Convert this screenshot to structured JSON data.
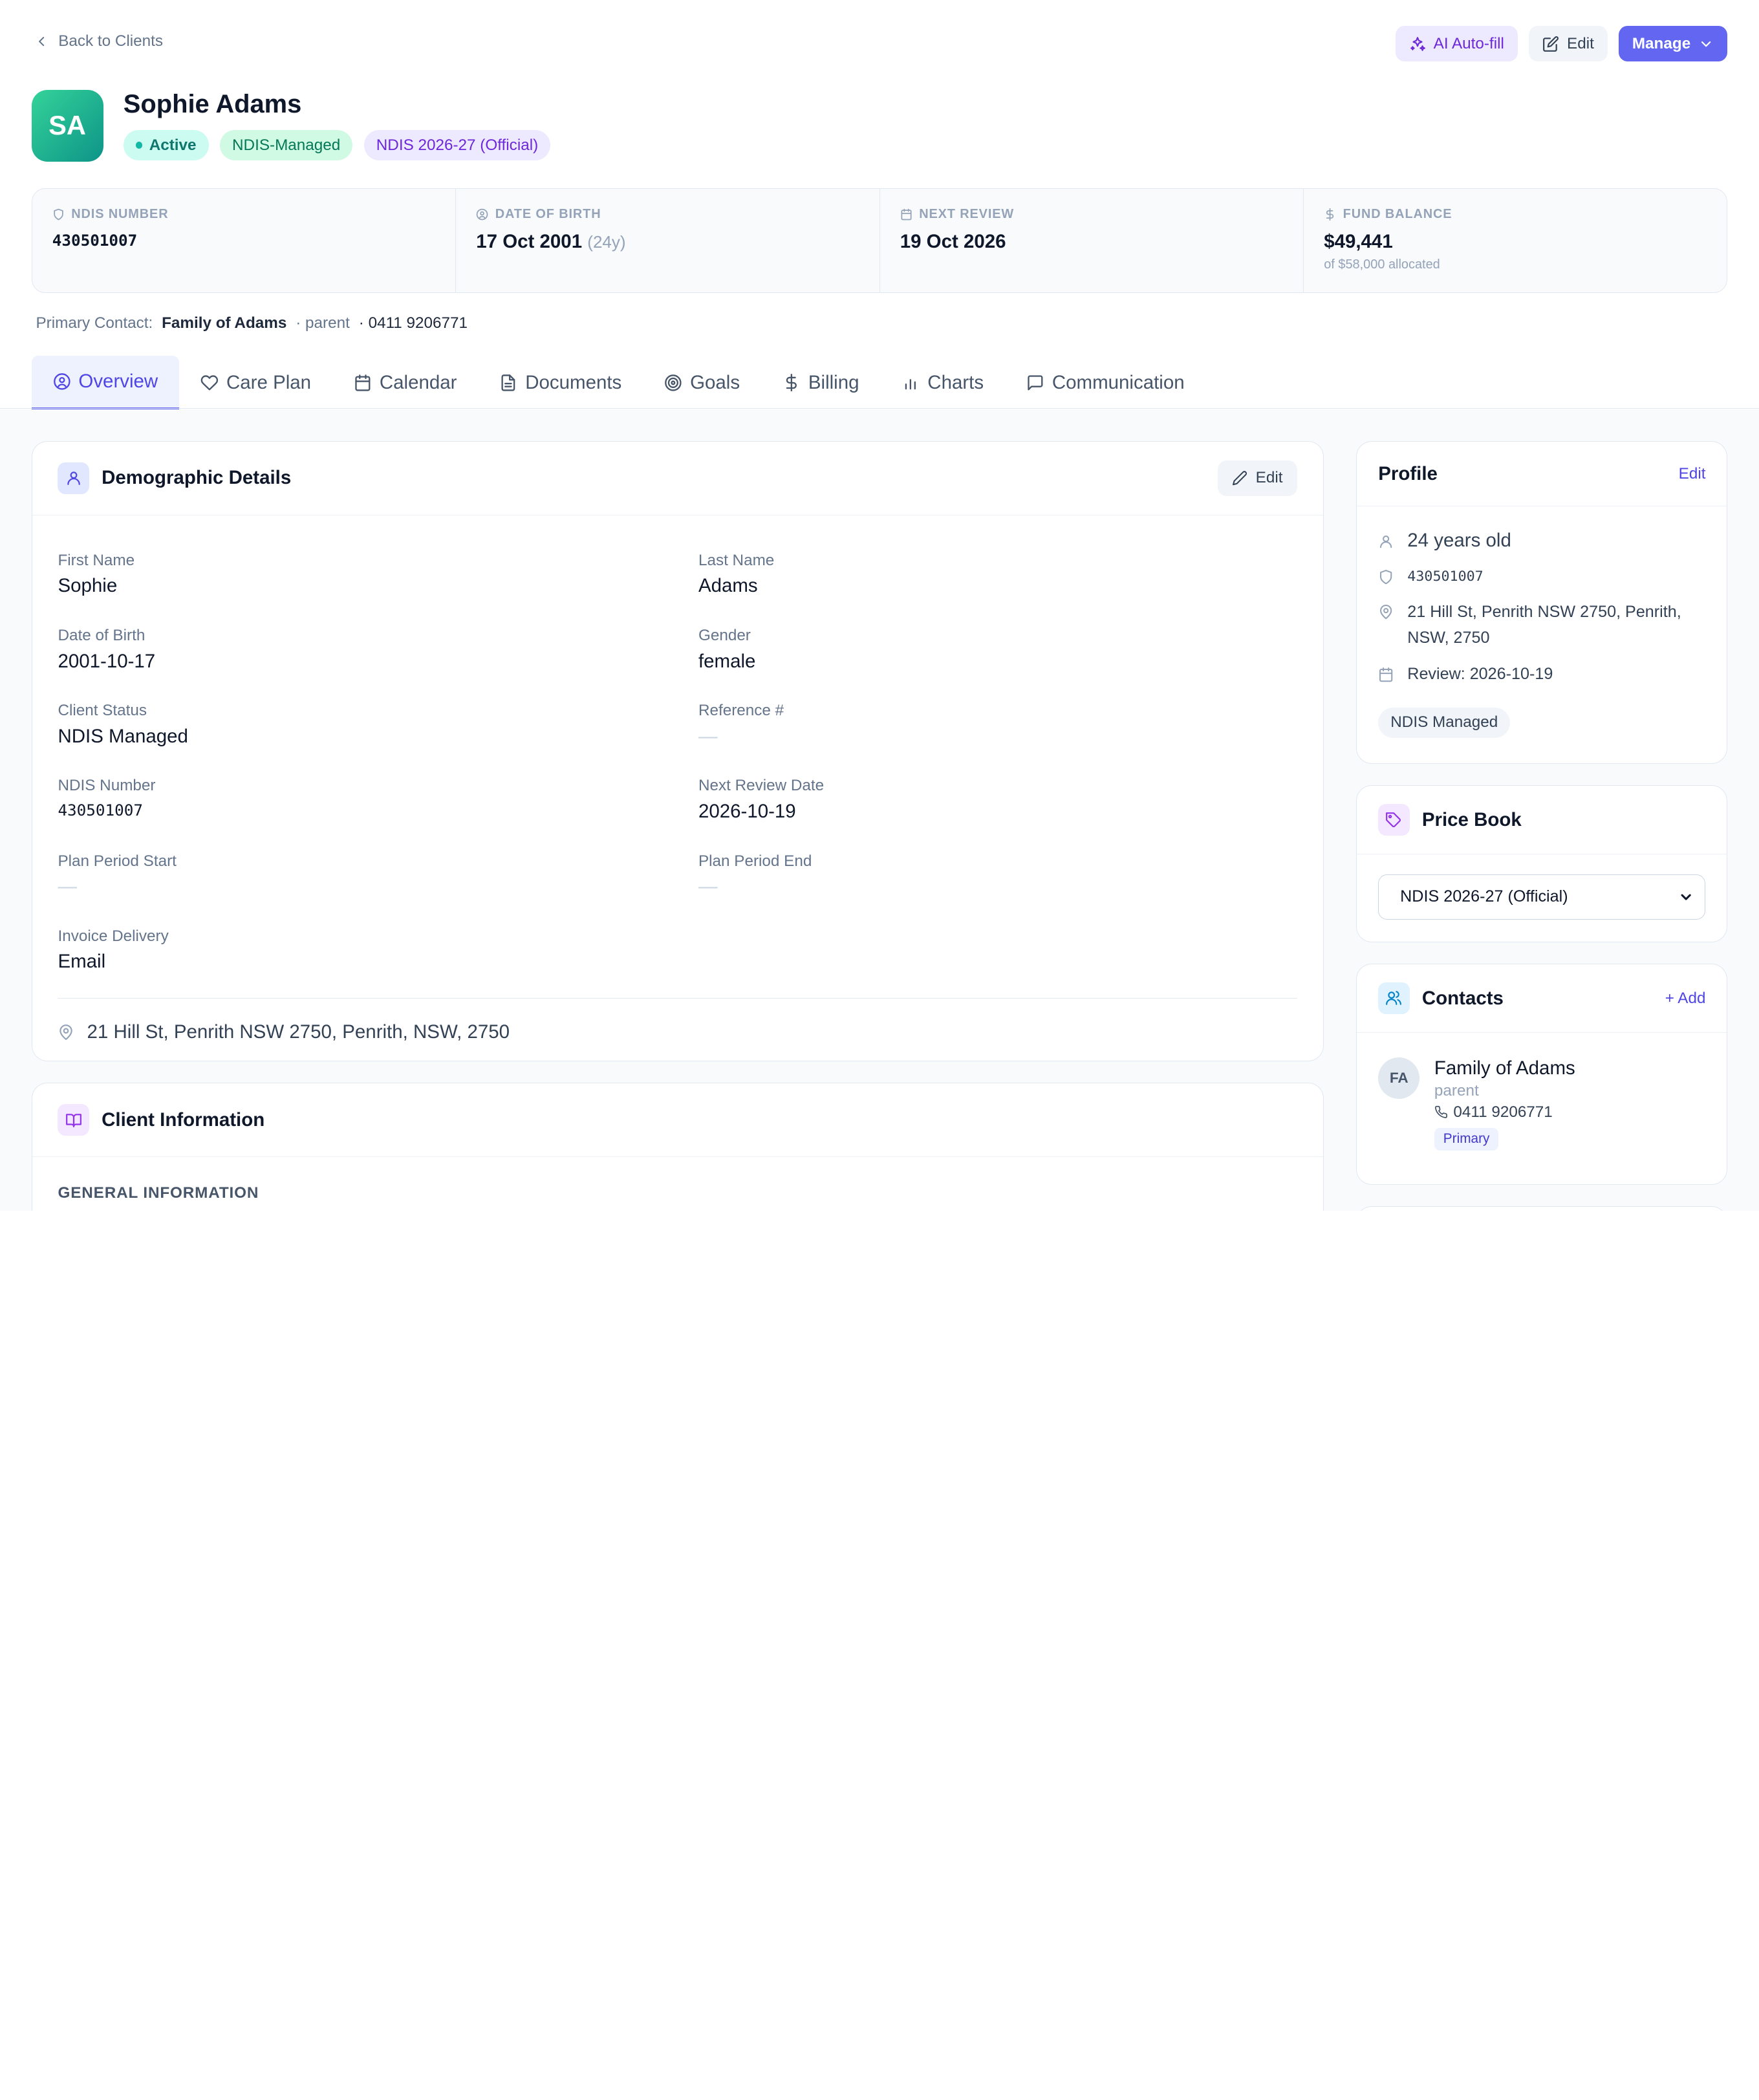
{
  "header": {
    "back_label": "Back to Clients",
    "ai_autofill_label": "AI Auto-fill",
    "edit_label": "Edit",
    "manage_label": "Manage"
  },
  "client": {
    "initials": "SA",
    "name": "Sophie Adams",
    "badges": {
      "status": "Active",
      "management": "NDIS-Managed",
      "price_book": "NDIS 2026-27 (Official)"
    }
  },
  "stats": {
    "ndis_number": {
      "label": "NDIS NUMBER",
      "value": "430501007"
    },
    "dob": {
      "label": "DATE OF BIRTH",
      "value": "17 Oct 2001",
      "age": "(24y)"
    },
    "next_review": {
      "label": "NEXT REVIEW",
      "value": "19 Oct 2026"
    },
    "fund_balance": {
      "label": "FUND BALANCE",
      "value": "$49,441",
      "note": "of $58,000 allocated"
    }
  },
  "primary_contact": {
    "label": "Primary Contact:",
    "name": "Family of Adams",
    "relation": "· parent",
    "phone": "· 0411 9206771"
  },
  "tabs": [
    {
      "label": "Overview",
      "icon": "user-circle-icon"
    },
    {
      "label": "Care Plan",
      "icon": "heart-icon"
    },
    {
      "label": "Calendar",
      "icon": "calendar-icon"
    },
    {
      "label": "Documents",
      "icon": "document-icon"
    },
    {
      "label": "Goals",
      "icon": "target-icon"
    },
    {
      "label": "Billing",
      "icon": "dollar-icon"
    },
    {
      "label": "Charts",
      "icon": "bar-chart-icon"
    },
    {
      "label": "Communication",
      "icon": "message-icon"
    }
  ],
  "demographics": {
    "title": "Demographic Details",
    "edit_label": "Edit",
    "fields": {
      "first_name": {
        "label": "First Name",
        "value": "Sophie"
      },
      "last_name": {
        "label": "Last Name",
        "value": "Adams"
      },
      "dob": {
        "label": "Date of Birth",
        "value": "2001-10-17"
      },
      "gender": {
        "label": "Gender",
        "value": "female"
      },
      "client_status": {
        "label": "Client Status",
        "value": "NDIS Managed"
      },
      "reference": {
        "label": "Reference #",
        "value": "—"
      },
      "ndis_number": {
        "label": "NDIS Number",
        "value": "430501007"
      },
      "next_review": {
        "label": "Next Review Date",
        "value": "2026-10-19"
      },
      "plan_start": {
        "label": "Plan Period Start",
        "value": "—"
      },
      "plan_end": {
        "label": "Plan Period End",
        "value": "—"
      },
      "invoice_delivery": {
        "label": "Invoice Delivery",
        "value": "Email"
      }
    },
    "address": "21 Hill St, Penrith NSW 2750, Penrith, NSW, 2750"
  },
  "client_info": {
    "title": "Client Information",
    "section": "GENERAL INFORMATION"
  },
  "profile": {
    "title": "Profile",
    "edit_label": "Edit",
    "age": "24 years old",
    "ndis": "430501007",
    "address_line1": "21 Hill St, Penrith NSW 2750, Penrith,",
    "address_line2": "NSW, 2750",
    "review": "Review: 2026-10-19",
    "tag": "NDIS Managed"
  },
  "price_book": {
    "title": "Price Book",
    "selected": "NDIS 2026-27 (Official)"
  },
  "contacts": {
    "title": "Contacts",
    "add_label": "+ Add",
    "items": [
      {
        "initials": "FA",
        "name": "Family of Adams",
        "relation": "parent",
        "phone": "0411 9206771",
        "badge": "Primary"
      }
    ]
  },
  "colors": {
    "accent": "#6366f1",
    "ai": "#6d28d9",
    "active": "#14b8a6"
  }
}
